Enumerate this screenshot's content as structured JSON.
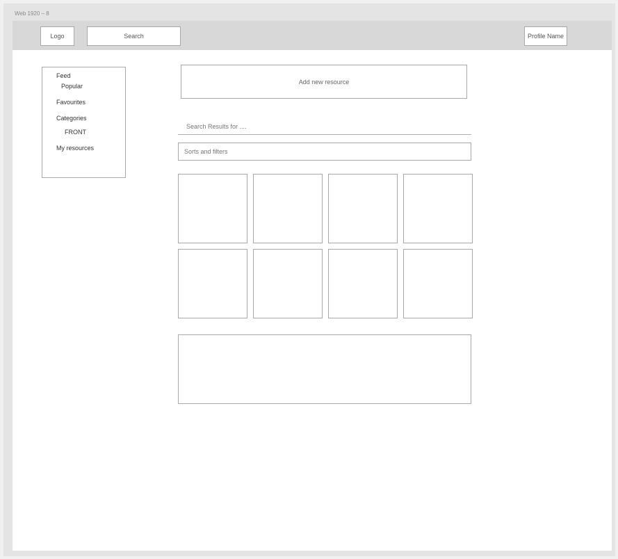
{
  "frame": {
    "label": "Web 1920 – 8"
  },
  "header": {
    "logo_label": "Logo",
    "search_label": "Search",
    "profile_label": "Profile Name"
  },
  "sidebar": {
    "items": [
      {
        "label": "Feed"
      },
      {
        "label": "Popular"
      },
      {
        "label": "Favourites"
      },
      {
        "label": "Categories"
      },
      {
        "label": "FRONT"
      },
      {
        "label": "My resources"
      }
    ]
  },
  "main": {
    "add_resource_label": "Add new resource",
    "results_title": "Search Results for ....",
    "filters_label": "Sorts and filters",
    "card_count": 8
  }
}
